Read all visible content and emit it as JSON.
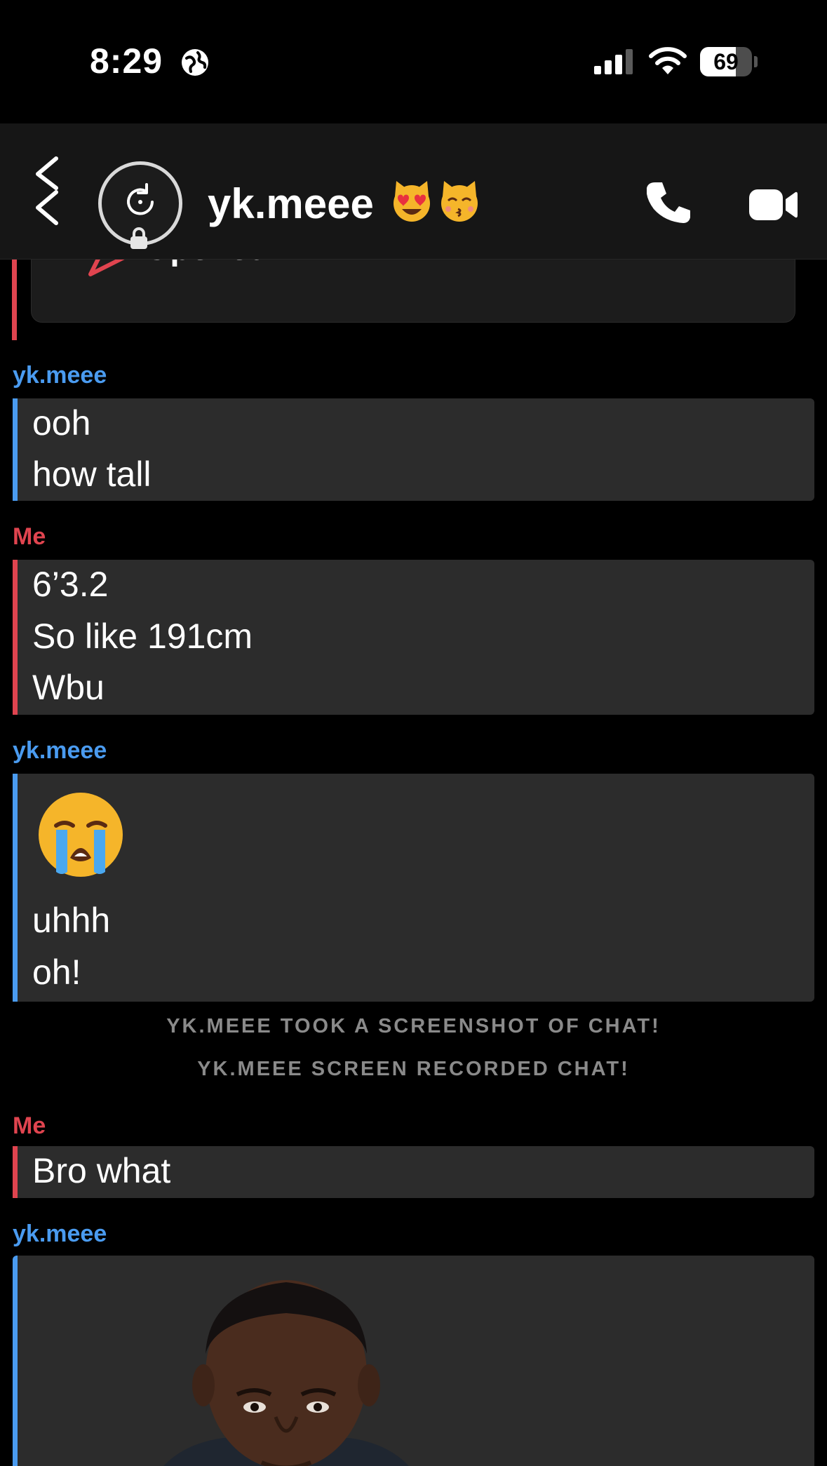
{
  "status_bar": {
    "time": "8:29",
    "battery": "69",
    "battery_level_percent": 69,
    "icons": [
      "globe-icon",
      "signal-icon",
      "wifi-icon",
      "battery-icon"
    ]
  },
  "header": {
    "title": "yk.meee",
    "title_emojis": [
      "heart-eyes-cat-emoji",
      "kissing-cat-emoji"
    ],
    "icons": [
      "back-chevron-icon",
      "avatar-placeholder-icon",
      "lock-icon",
      "phone-icon",
      "video-camera-icon"
    ]
  },
  "chat": {
    "opened_status": "Opened",
    "messages": [
      {
        "sender": "yk.meee",
        "side": "them",
        "lines": [
          "ooh",
          "how tall"
        ]
      },
      {
        "sender": "Me",
        "side": "me",
        "lines": [
          "6’3.2",
          "So like 191cm",
          "Wbu"
        ]
      },
      {
        "sender": "yk.meee",
        "side": "them",
        "emoji": "loudly-crying-face-emoji",
        "lines": [
          "uhhh",
          "oh!"
        ]
      },
      {
        "sender": "Me",
        "side": "me",
        "lines": [
          "Bro what"
        ]
      },
      {
        "sender": "yk.meee",
        "side": "them",
        "image": "portrait-photo"
      }
    ],
    "system_notes": [
      "YK.MEEE TOOK A SCREENSHOT OF CHAT!",
      "YK.MEEE SCREEN RECORDED CHAT!"
    ]
  },
  "colors": {
    "background": "#000000",
    "header_bg": "#161616",
    "bubble_bg": "#2c2c2c",
    "them_accent": "#4a9bf0",
    "me_accent": "#e0444f",
    "system_text": "#8a8a8a"
  }
}
